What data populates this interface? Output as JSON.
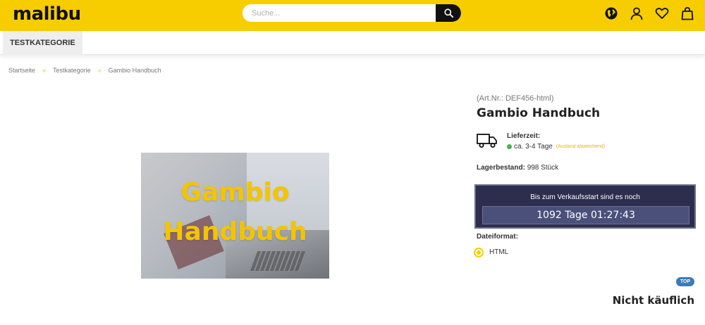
{
  "header": {
    "logo": "malibu",
    "search": {
      "placeholder": "Suche..."
    },
    "icons": [
      "globe-icon",
      "user-icon",
      "heart-icon",
      "shopping-bag-icon"
    ],
    "brand_color": "#f7cd00"
  },
  "nav": {
    "items": [
      {
        "label": "TESTKATEGORIE"
      }
    ]
  },
  "breadcrumb": [
    "Startseite",
    "Testkategorie",
    "Gambio Handbuch"
  ],
  "product": {
    "image_text_line1": "Gambio",
    "image_text_line2": "Handbuch",
    "art_nr": "(Art.Nr.: DEF456-html)",
    "title": "Gambio Handbuch",
    "lieferzeit_label": "Lieferzeit:",
    "lieferzeit_value": "ca. 3-4 Tage",
    "lieferzeit_note": "(Ausland abweichend)",
    "lagerbestand_label": "Lagerbestand:",
    "lagerbestand_value": "998 Stück",
    "countdown_label": "Bis zum Verkaufsstart sind es noch",
    "countdown_value": "1092 Tage 01:27:43",
    "dateiformat_label": "Dateiformat:",
    "dateiformat_option": "HTML",
    "status": "Nicht käuflich"
  },
  "top_button": "TOP"
}
